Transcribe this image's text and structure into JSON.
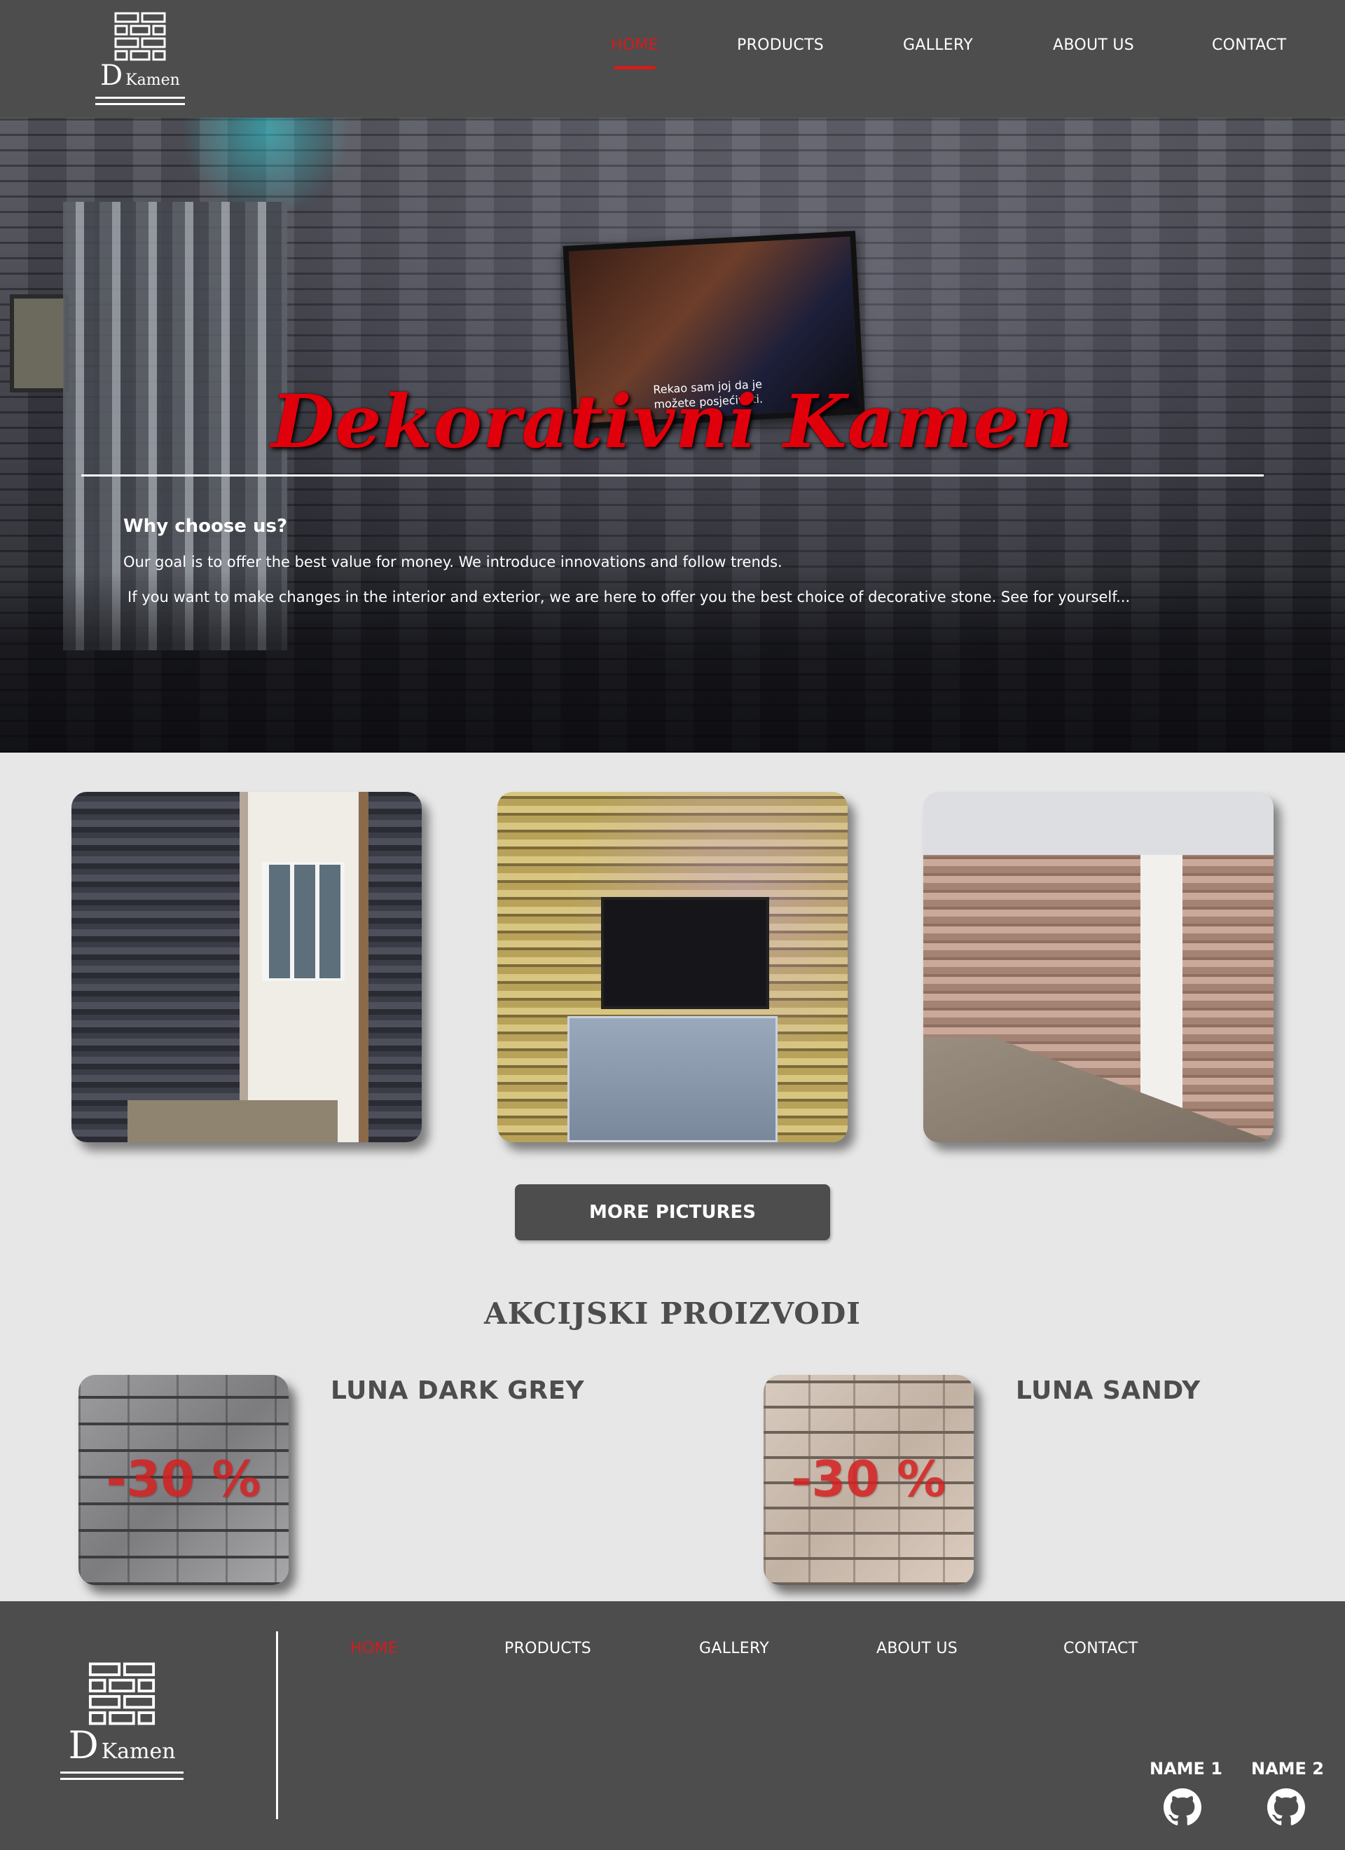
{
  "brand": {
    "letter": "D",
    "name": "Kamen"
  },
  "nav": {
    "items": [
      {
        "label": "HOME",
        "active": true
      },
      {
        "label": "PRODUCTS",
        "active": false
      },
      {
        "label": "GALLERY",
        "active": false
      },
      {
        "label": "ABOUT US",
        "active": false
      },
      {
        "label": "CONTACT",
        "active": false
      }
    ]
  },
  "hero": {
    "title": "Dekorativni Kamen",
    "tv_caption_line1": "Rekao sam joj da je",
    "tv_caption_line2": "možete posjećivati.",
    "why_title": "Why choose us?",
    "line1": "Our goal is to offer the best value for money. We introduce innovations and follow trends.",
    "line2": "If you want to make changes in the interior and exterior, we are here to offer you the best choice of decorative stone. See for yourself..."
  },
  "gallery": {
    "more_button": "MORE PICTURES"
  },
  "sales": {
    "heading": "AKCIJSKI PROIZVODI",
    "products": [
      {
        "name": "LUNA DARK GREY",
        "discount": "-30 %"
      },
      {
        "name": "LUNA SANDY",
        "discount": "-30 %"
      }
    ]
  },
  "footer": {
    "credits": [
      {
        "name": "NAME 1",
        "icon": "github-icon"
      },
      {
        "name": "NAME 2",
        "icon": "github-icon"
      }
    ]
  },
  "colors": {
    "header_bg": "#4d4d4d",
    "page_bg": "#e7e7e7",
    "accent_red": "#d41c1c",
    "hero_title_red": "#e0000b"
  }
}
